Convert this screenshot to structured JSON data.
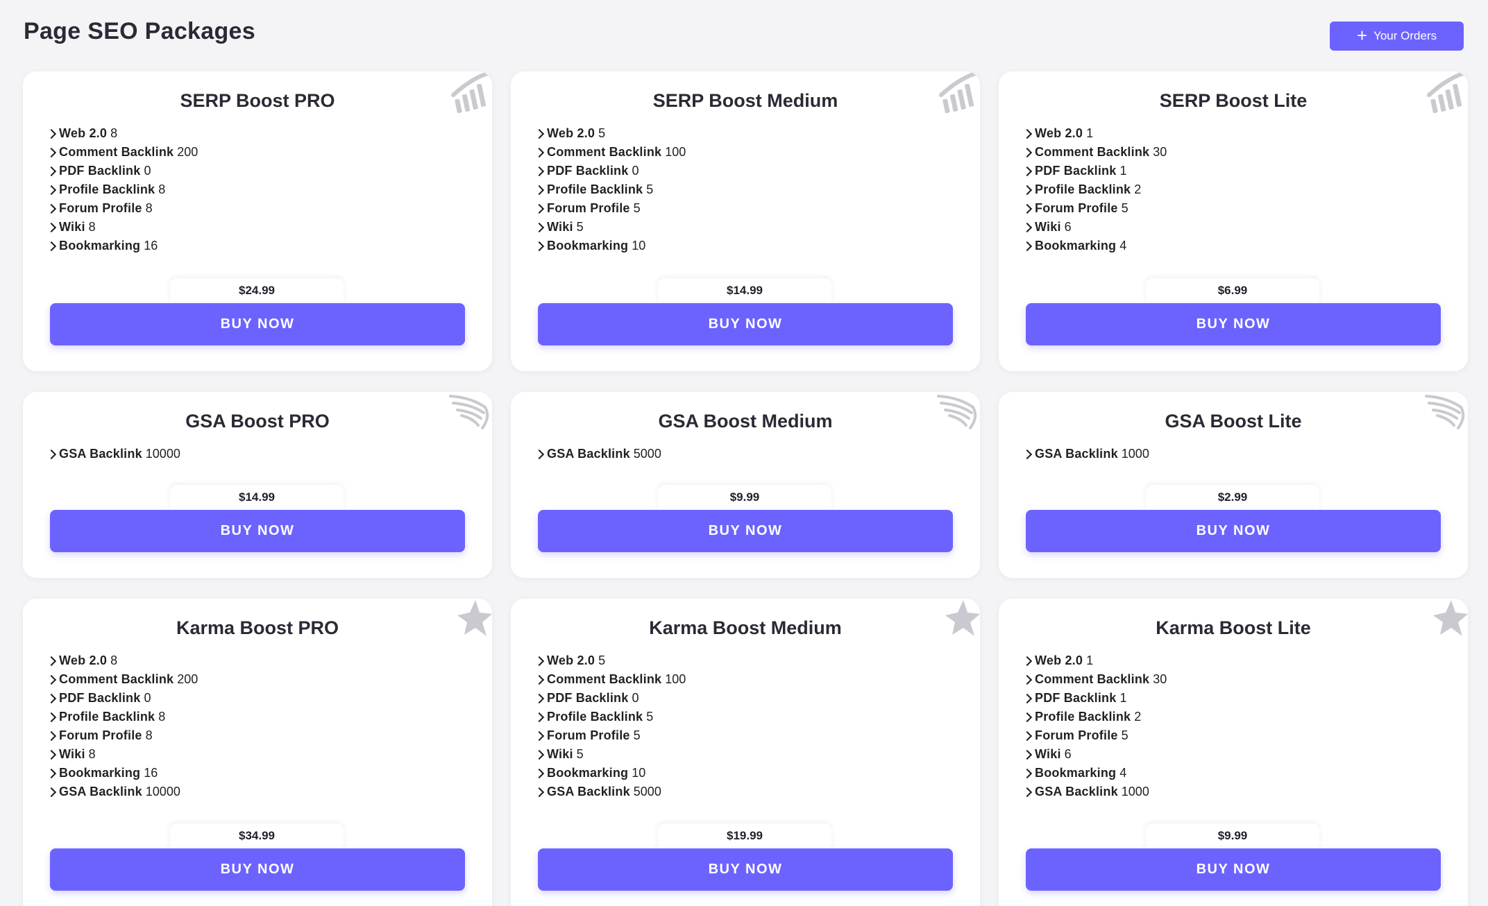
{
  "header": {
    "title": "Page SEO Packages",
    "orders_button": "Your Orders"
  },
  "colors": {
    "accent": "#6c63ff",
    "background": "#f4f4f7",
    "card": "#ffffff",
    "icon": "#c9c9cf"
  },
  "buy_label": "BUY NOW",
  "packages": [
    {
      "title": "SERP Boost PRO",
      "icon": "chart-icon",
      "price": "$24.99",
      "features": [
        {
          "name": "Web 2.0",
          "value": "8"
        },
        {
          "name": "Comment Backlink",
          "value": "200"
        },
        {
          "name": "PDF Backlink",
          "value": "0"
        },
        {
          "name": "Profile Backlink",
          "value": "8"
        },
        {
          "name": "Forum Profile",
          "value": "8"
        },
        {
          "name": "Wiki",
          "value": "8"
        },
        {
          "name": "Bookmarking",
          "value": "16"
        }
      ]
    },
    {
      "title": "SERP Boost Medium",
      "icon": "chart-icon",
      "price": "$14.99",
      "features": [
        {
          "name": "Web 2.0",
          "value": "5"
        },
        {
          "name": "Comment Backlink",
          "value": "100"
        },
        {
          "name": "PDF Backlink",
          "value": "0"
        },
        {
          "name": "Profile Backlink",
          "value": "5"
        },
        {
          "name": "Forum Profile",
          "value": "5"
        },
        {
          "name": "Wiki",
          "value": "5"
        },
        {
          "name": "Bookmarking",
          "value": "10"
        }
      ]
    },
    {
      "title": "SERP Boost Lite",
      "icon": "chart-icon",
      "price": "$6.99",
      "features": [
        {
          "name": "Web 2.0",
          "value": "1"
        },
        {
          "name": "Comment Backlink",
          "value": "30"
        },
        {
          "name": "PDF Backlink",
          "value": "1"
        },
        {
          "name": "Profile Backlink",
          "value": "2"
        },
        {
          "name": "Forum Profile",
          "value": "5"
        },
        {
          "name": "Wiki",
          "value": "6"
        },
        {
          "name": "Bookmarking",
          "value": "4"
        }
      ]
    },
    {
      "title": "GSA Boost PRO",
      "icon": "wing-icon",
      "price": "$14.99",
      "features": [
        {
          "name": "GSA Backlink",
          "value": "10000"
        }
      ]
    },
    {
      "title": "GSA Boost Medium",
      "icon": "wing-icon",
      "price": "$9.99",
      "features": [
        {
          "name": "GSA Backlink",
          "value": "5000"
        }
      ]
    },
    {
      "title": "GSA Boost Lite",
      "icon": "wing-icon",
      "price": "$2.99",
      "features": [
        {
          "name": "GSA Backlink",
          "value": "1000"
        }
      ]
    },
    {
      "title": "Karma Boost PRO",
      "icon": "star-icon",
      "price": "$34.99",
      "features": [
        {
          "name": "Web 2.0",
          "value": "8"
        },
        {
          "name": "Comment Backlink",
          "value": "200"
        },
        {
          "name": "PDF Backlink",
          "value": "0"
        },
        {
          "name": "Profile Backlink",
          "value": "8"
        },
        {
          "name": "Forum Profile",
          "value": "8"
        },
        {
          "name": "Wiki",
          "value": "8"
        },
        {
          "name": "Bookmarking",
          "value": "16"
        },
        {
          "name": "GSA Backlink",
          "value": "10000"
        }
      ]
    },
    {
      "title": "Karma Boost Medium",
      "icon": "star-icon",
      "price": "$19.99",
      "features": [
        {
          "name": "Web 2.0",
          "value": "5"
        },
        {
          "name": "Comment Backlink",
          "value": "100"
        },
        {
          "name": "PDF Backlink",
          "value": "0"
        },
        {
          "name": "Profile Backlink",
          "value": "5"
        },
        {
          "name": "Forum Profile",
          "value": "5"
        },
        {
          "name": "Wiki",
          "value": "5"
        },
        {
          "name": "Bookmarking",
          "value": "10"
        },
        {
          "name": "GSA Backlink",
          "value": "5000"
        }
      ]
    },
    {
      "title": "Karma Boost Lite",
      "icon": "star-icon",
      "price": "$9.99",
      "features": [
        {
          "name": "Web 2.0",
          "value": "1"
        },
        {
          "name": "Comment Backlink",
          "value": "30"
        },
        {
          "name": "PDF Backlink",
          "value": "1"
        },
        {
          "name": "Profile Backlink",
          "value": "2"
        },
        {
          "name": "Forum Profile",
          "value": "5"
        },
        {
          "name": "Wiki",
          "value": "6"
        },
        {
          "name": "Bookmarking",
          "value": "4"
        },
        {
          "name": "GSA Backlink",
          "value": "1000"
        }
      ]
    }
  ]
}
